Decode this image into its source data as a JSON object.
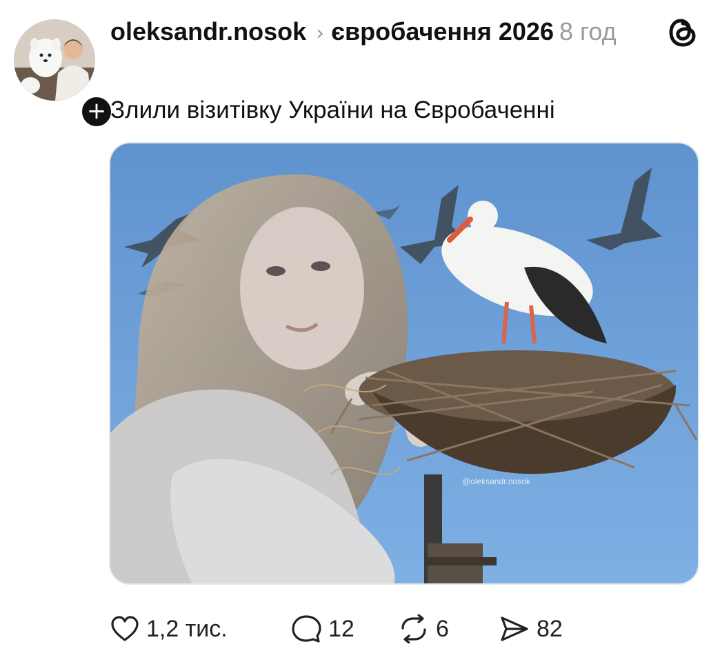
{
  "post": {
    "author": "oleksandr.nosok",
    "separator": "›",
    "topic": "євробачення 2026",
    "time": "8 год",
    "text": "Злили візитівку України на Євробаченні",
    "follow_symbol": "+",
    "watermark": "@oleksandr.nosok"
  },
  "actions": {
    "likes": "1,2 тис.",
    "replies": "12",
    "reposts": "6",
    "shares": "82"
  },
  "icons": {
    "app_logo": "threads-logo-icon",
    "like": "heart-icon",
    "reply": "comment-bubble-icon",
    "repost": "repost-arrows-icon",
    "share": "send-icon"
  },
  "colors": {
    "text": "#111111",
    "muted": "#9a9a9a",
    "sky": "#6e9fd6"
  }
}
